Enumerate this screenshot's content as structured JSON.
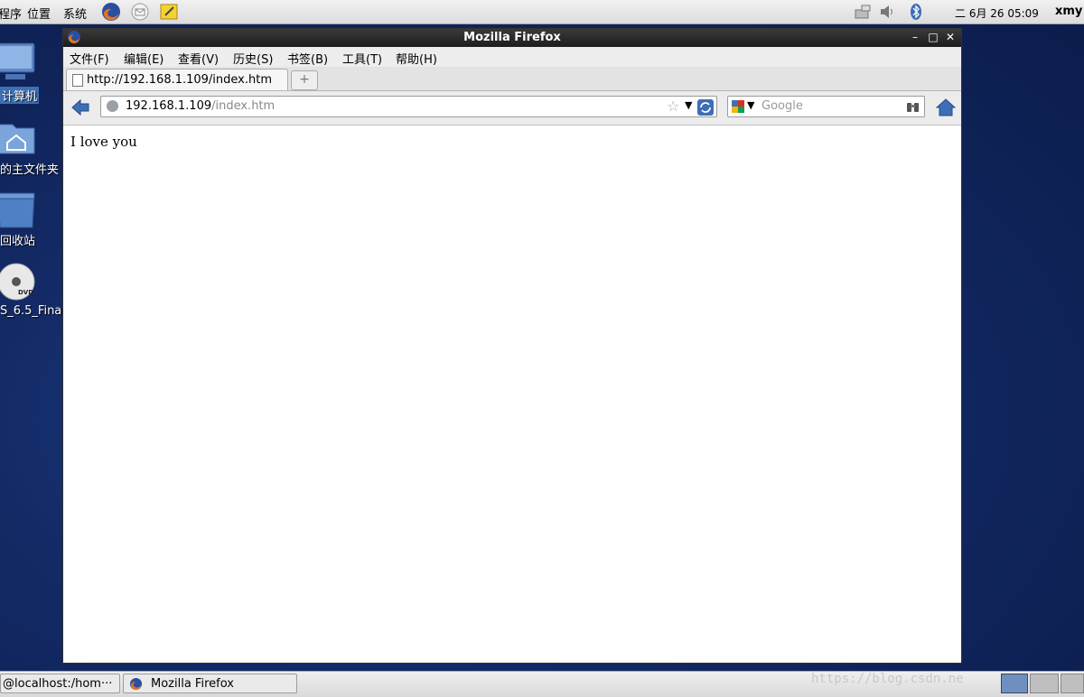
{
  "top_panel": {
    "menus": [
      "程序",
      "位置",
      "系统"
    ],
    "clock": "二 6月 26 05:09",
    "user": "xmy"
  },
  "desktop": {
    "icons": [
      {
        "label": "计算机",
        "icon": "computer-icon"
      },
      {
        "label": "的主文件夹",
        "icon": "home-folder-icon"
      },
      {
        "label": "回收站",
        "icon": "trash-icon"
      },
      {
        "label": "S_6.5_Fina",
        "icon": "dvd-icon"
      }
    ]
  },
  "window": {
    "title": "Mozilla Firefox",
    "menus": [
      "文件(F)",
      "编辑(E)",
      "查看(V)",
      "历史(S)",
      "书签(B)",
      "工具(T)",
      "帮助(H)"
    ],
    "tab": {
      "label": "http://192.168.1.109/index.htm"
    },
    "newtab_symbol": "+",
    "url": {
      "host": "192.168.1.109",
      "path": "/index.htm"
    },
    "search": {
      "placeholder": "Google"
    },
    "content_text": "I love you"
  },
  "taskbar": {
    "items": [
      {
        "label": "@localhost:/hom···"
      },
      {
        "label": "Mozilla Firefox"
      }
    ],
    "watermark": "https://blog.csdn.ne"
  },
  "colors": {
    "titlebar": "#2a2a2a",
    "desktop": "#132a66",
    "accent": "#3d6fb5"
  }
}
